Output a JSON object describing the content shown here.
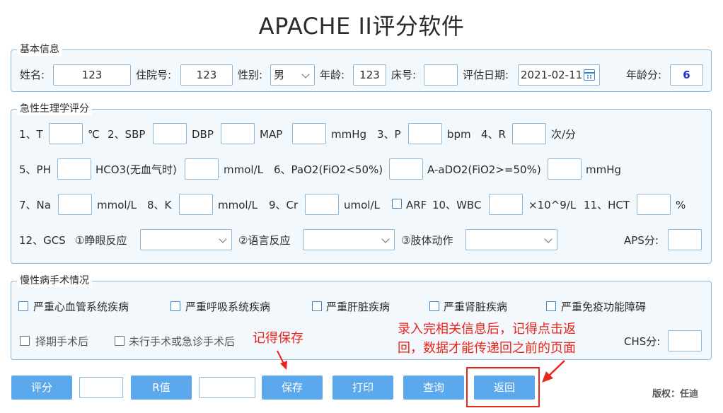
{
  "title": "APACHE II评分软件",
  "basic": {
    "legend": "基本信息",
    "name_label": "姓名:",
    "name_value": "123",
    "admission_label": "住院号:",
    "admission_value": "123",
    "gender_label": "性别:",
    "gender_value": "男",
    "age_label": "年龄:",
    "age_value": "123",
    "bed_label": "床号:",
    "bed_value": "",
    "date_label": "评估日期:",
    "date_value": "2021-02-11",
    "age_score_label": "年龄分:",
    "age_score_value": "6"
  },
  "physio": {
    "legend": "急性生理学评分",
    "t_label": "1、T",
    "t_unit": "℃",
    "sbp_label": "2、SBP",
    "dbp_label": "DBP",
    "map_label": "MAP",
    "bp_unit": "mmHg",
    "p_label": "3、P",
    "p_unit": "bpm",
    "r_label": "4、R",
    "r_unit": "次/分",
    "ph_label": "5、PH",
    "hco3_label": "HCO3(无血气时)",
    "hco3_unit": "mmol/L",
    "pao2_label": "6、PaO2(FiO2<50%)",
    "aado2_label": "A-aDO2(FiO2>=50%)",
    "o2_unit": "mmHg",
    "na_label": "7、Na",
    "na_unit": "mmol/L",
    "k_label": "8、K",
    "k_unit": "mmol/L",
    "cr_label": "9、Cr",
    "cr_unit": "umol/L",
    "arf_label": "ARF",
    "wbc_label": "10、WBC",
    "wbc_unit": "×10^9/L",
    "hct_label": "11、HCT",
    "hct_unit": "%",
    "gcs_label": "12、GCS",
    "eye_label": "①睁眼反应",
    "verbal_label": "②语言反应",
    "motor_label": "③肢体动作",
    "aps_label": "APS分:"
  },
  "chronic": {
    "legend": "慢性病手术情况",
    "items": [
      "严重心血管系统疾病",
      "严重呼吸系统疾病",
      "严重肝脏疾病",
      "严重肾脏疾病",
      "严重免疫功能障碍"
    ],
    "surgery": [
      "择期手术后",
      "未行手术或急诊手术后"
    ],
    "chs_label": "CHS分:"
  },
  "toolbar": {
    "score": "评分",
    "r_value": "R值",
    "save": "保存",
    "print": "打印",
    "query": "查询",
    "back": "返回"
  },
  "annotations": {
    "save_note": "记得保存",
    "back_note_line1": "录入完相关信息后，记得点击返",
    "back_note_line2": "回，数据才能传递回之前的页面"
  },
  "copyright": "版权：任迪",
  "colors": {
    "accent": "#5ca8ec",
    "border": "#8fb8d8",
    "annotation": "#e8261c",
    "score_value": "#1a33c9"
  }
}
